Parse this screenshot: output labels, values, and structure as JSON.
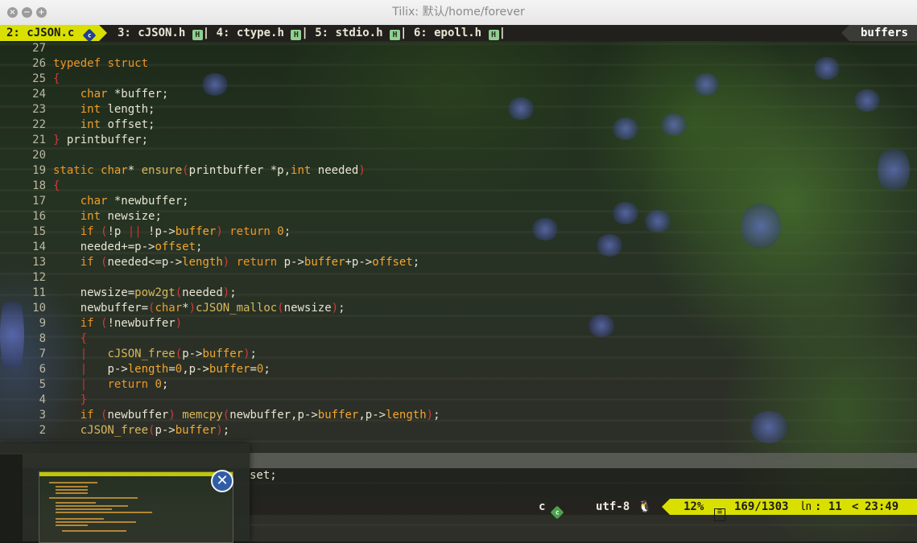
{
  "window": {
    "title": "Tilix: 默认/home/forever",
    "buttons": {
      "close": "×",
      "minimize": "−",
      "maximize": "+"
    }
  },
  "tabline": {
    "active": {
      "label": "2: cJSON.c",
      "icon": "c-language-icon",
      "icon_text": "c"
    },
    "tabs": [
      {
        "label": "3: cJSON.h",
        "badge": "H"
      },
      {
        "label": "4: ctype.h",
        "badge": "H"
      },
      {
        "label": "5: stdio.h",
        "badge": "H"
      },
      {
        "label": "6: epoll.h",
        "badge": "H"
      }
    ],
    "separator": "|",
    "buffers_label": "buffers"
  },
  "editor": {
    "lines": [
      {
        "num": "27",
        "text": ""
      },
      {
        "num": "26",
        "text": "typedef struct"
      },
      {
        "num": "25",
        "text": "{"
      },
      {
        "num": "24",
        "text": "    char *buffer;"
      },
      {
        "num": "23",
        "text": "    int length;"
      },
      {
        "num": "22",
        "text": "    int offset;"
      },
      {
        "num": "21",
        "text": "} printbuffer;"
      },
      {
        "num": "20",
        "text": ""
      },
      {
        "num": "19",
        "text": "static char* ensure(printbuffer *p,int needed)"
      },
      {
        "num": "18",
        "text": "{"
      },
      {
        "num": "17",
        "text": "    char *newbuffer;"
      },
      {
        "num": "16",
        "text": "    int newsize;"
      },
      {
        "num": "15",
        "text": "    if (!p || !p->buffer) return 0;"
      },
      {
        "num": "14",
        "text": "    needed+=p->offset;"
      },
      {
        "num": "13",
        "text": "    if (needed<=p->length) return p->buffer+p->offset;"
      },
      {
        "num": "12",
        "text": ""
      },
      {
        "num": "11",
        "text": "    newsize=pow2gt(needed);"
      },
      {
        "num": "10",
        "text": "    newbuffer=(char*)cJSON_malloc(newsize);"
      },
      {
        "num": "9",
        "text": "    if (!newbuffer)"
      },
      {
        "num": "8",
        "text": "    {"
      },
      {
        "num": "7",
        "text": "    |   cJSON_free(p->buffer);"
      },
      {
        "num": "6",
        "text": "    |   p->length=0,p->buffer=0;"
      },
      {
        "num": "5",
        "text": "    |   return 0;"
      },
      {
        "num": "4",
        "text": "    }"
      },
      {
        "num": "3",
        "text": "    if (newbuffer) memcpy(newbuffer,p->buffer,p->length);"
      },
      {
        "num": "2",
        "text": "    cJSON_free(p->buffer);"
      }
    ],
    "command_line_text": "set;"
  },
  "statusline": {
    "filetype": "c",
    "filetype_icon": "c-language-icon",
    "encoding": "utf-8",
    "os_icon": "linux-tux-icon",
    "os_glyph": "🐧",
    "percent": "12%",
    "line_info": "169/1303",
    "ln_symbol": "㏑",
    "column": ": 11",
    "time_arrow": "<",
    "time": "23:49"
  },
  "preview": {
    "close_glyph": "✕"
  },
  "colors": {
    "accent": "#d9e000",
    "keyword": "#ee9424",
    "paren": "#d23a3a",
    "close_button": "#2f5da6"
  }
}
